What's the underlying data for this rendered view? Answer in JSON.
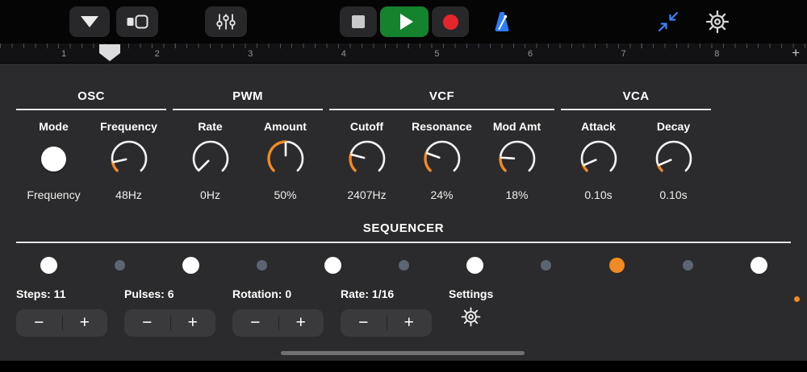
{
  "toolbar": {
    "icons": {
      "nav": "triangle-down-icon",
      "view": "view-selector-icon",
      "mixer": "track-controls-sliders-icon",
      "stop": "stop-icon",
      "play": "play-icon",
      "record": "record-icon",
      "metronome": "metronome-icon",
      "collapse": "collapse-arrows-icon",
      "settings": "gear-icon"
    }
  },
  "ruler": {
    "bars": [
      "1",
      "2",
      "3",
      "4",
      "5",
      "6",
      "7",
      "8"
    ],
    "add_label": "+"
  },
  "panel": {
    "sections": [
      {
        "title": "OSC",
        "controls": [
          {
            "key": "mode",
            "label": "Mode",
            "type": "button",
            "value": "Frequency"
          },
          {
            "key": "frequency",
            "label": "Frequency",
            "type": "knob",
            "value": "48Hz",
            "fraction": 0.12
          }
        ]
      },
      {
        "title": "PWM",
        "controls": [
          {
            "key": "rate",
            "label": "Rate",
            "type": "knob",
            "value": "0Hz",
            "fraction": 0.0
          },
          {
            "key": "amount",
            "label": "Amount",
            "type": "knob",
            "value": "50%",
            "fraction": 0.5
          }
        ]
      },
      {
        "title": "VCF",
        "controls": [
          {
            "key": "cutoff",
            "label": "Cutoff",
            "type": "knob",
            "value": "2407Hz",
            "fraction": 0.22
          },
          {
            "key": "resonance",
            "label": "Resonance",
            "type": "knob",
            "value": "24%",
            "fraction": 0.24
          },
          {
            "key": "mod-amt",
            "label": "Mod Amt",
            "type": "knob",
            "value": "18%",
            "fraction": 0.18
          }
        ]
      },
      {
        "title": "VCA",
        "controls": [
          {
            "key": "attack",
            "label": "Attack",
            "type": "knob",
            "value": "0.10s",
            "fraction": 0.08
          },
          {
            "key": "decay",
            "label": "Decay",
            "type": "knob",
            "value": "0.10s",
            "fraction": 0.08
          }
        ]
      }
    ],
    "sequencer": {
      "title": "SEQUENCER",
      "steps": [
        "on",
        "off",
        "on",
        "off",
        "on",
        "off",
        "on",
        "off",
        "current",
        "off",
        "on"
      ],
      "controls": [
        {
          "key": "steps",
          "label": "Steps:",
          "value": "11"
        },
        {
          "key": "pulses",
          "label": "Pulses:",
          "value": "6"
        },
        {
          "key": "rotation",
          "label": "Rotation:",
          "value": "0"
        },
        {
          "key": "rate",
          "label": "Rate:",
          "value": "1/16"
        }
      ],
      "minus_label": "−",
      "plus_label": "+",
      "settings_label": "Settings"
    }
  },
  "colors": {
    "accent_orange": "#F08A24",
    "accent_blue": "#3C82F7",
    "play_green": "#15832D",
    "record_red": "#E3262B",
    "panel_bg": "#2b2b2d",
    "step_off": "#5d6572"
  }
}
